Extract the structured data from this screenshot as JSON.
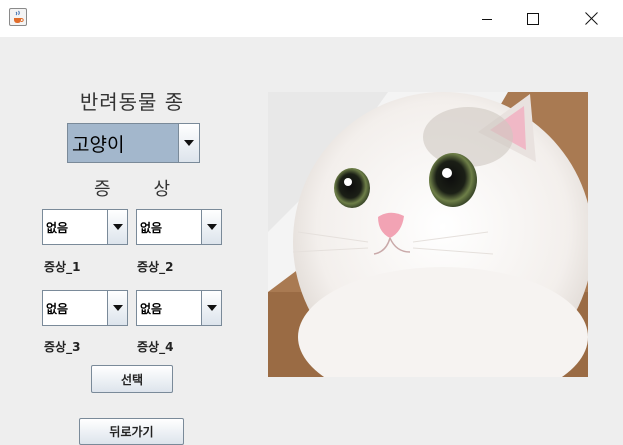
{
  "window": {
    "icon": "java-cup-icon",
    "controls": [
      "minimize-icon",
      "maximize-icon",
      "close-icon"
    ]
  },
  "species": {
    "label": "반려동물 종",
    "selected": "고양이"
  },
  "symptoms": {
    "label_char_1": "증",
    "label_char_2": "상",
    "items": [
      {
        "selected": "없음",
        "label": "증상_1"
      },
      {
        "selected": "없음",
        "label": "증상_2"
      },
      {
        "selected": "없음",
        "label": "증상_3"
      },
      {
        "selected": "없음",
        "label": "증상_4"
      }
    ]
  },
  "buttons": {
    "select": "선택",
    "back": "뒤로가기"
  },
  "colors": {
    "window_bg": "#eeeeee",
    "titlebar_bg": "#ffffff",
    "combo_selection": "#a3b7cc"
  }
}
